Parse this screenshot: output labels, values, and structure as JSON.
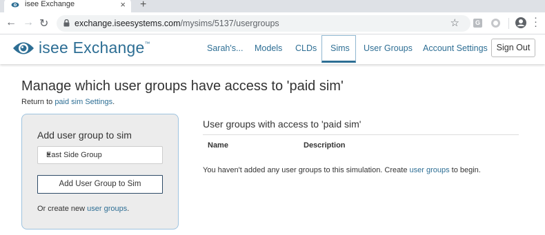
{
  "browser": {
    "tab_title": "isee Exchange",
    "tab_close": "×",
    "new_tab": "+",
    "url_host": "exchange.iseesystems.com",
    "url_path": "/mysims/5137/usergroups",
    "ext_letter": "G"
  },
  "header": {
    "logo": "isee Exchange",
    "trademark": "™",
    "nav": [
      "Sarah's...",
      "Models",
      "CLDs",
      "Sims",
      "User Groups",
      "Account Settings"
    ],
    "active_nav": "Sims",
    "signout_label": "Sign Out",
    "brand_color": "#2d6e94"
  },
  "page": {
    "title": "Manage which user groups have access to 'paid sim'",
    "return_prefix": "Return to ",
    "return_link": "paid sim Settings",
    "return_suffix": "."
  },
  "add_card": {
    "title": "Add user group to sim",
    "selected_group": "East Side Group",
    "button_label": "Add User Group to Sim",
    "footer_prefix": "Or create new ",
    "footer_link": "user groups",
    "footer_suffix": "."
  },
  "groups_section": {
    "title": "User groups with access to 'paid sim'",
    "columns": [
      "Name",
      "Description"
    ],
    "empty_prefix": "You haven't added any user groups to this simulation. Create ",
    "empty_link": "user groups",
    "empty_suffix": " to begin."
  }
}
